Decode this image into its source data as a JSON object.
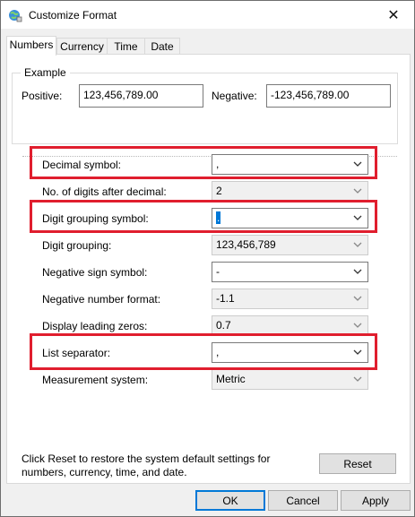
{
  "window": {
    "title": "Customize Format",
    "close_glyph": "✕"
  },
  "tabs": [
    {
      "label": "Numbers"
    },
    {
      "label": "Currency"
    },
    {
      "label": "Time"
    },
    {
      "label": "Date"
    }
  ],
  "example": {
    "legend": "Example",
    "positive_label": "Positive:",
    "positive_value": "123,456,789.00",
    "negative_label": "Negative:",
    "negative_value": "-123,456,789.00"
  },
  "settings": [
    {
      "label": "Decimal symbol:",
      "value": ","
    },
    {
      "label": "No. of digits after decimal:",
      "value": "2"
    },
    {
      "label": "Digit grouping symbol:",
      "value": "."
    },
    {
      "label": "Digit grouping:",
      "value": "123,456,789"
    },
    {
      "label": "Negative sign symbol:",
      "value": "-"
    },
    {
      "label": "Negative number format:",
      "value": "-1.1"
    },
    {
      "label": "Display leading zeros:",
      "value": "0.7"
    },
    {
      "label": "List separator:",
      "value": ","
    },
    {
      "label": "Measurement system:",
      "value": "Metric"
    }
  ],
  "footer": {
    "reset_text": "Click Reset to restore the system default settings for numbers, currency, time, and date.",
    "reset_button": "Reset"
  },
  "buttons": {
    "ok": "OK",
    "cancel": "Cancel",
    "apply": "Apply"
  },
  "colors": {
    "highlight": "#e01e2e",
    "accent": "#0078d7"
  },
  "icons": {
    "title": "globe-settings-icon",
    "dropdown": "chevron-down-icon"
  }
}
